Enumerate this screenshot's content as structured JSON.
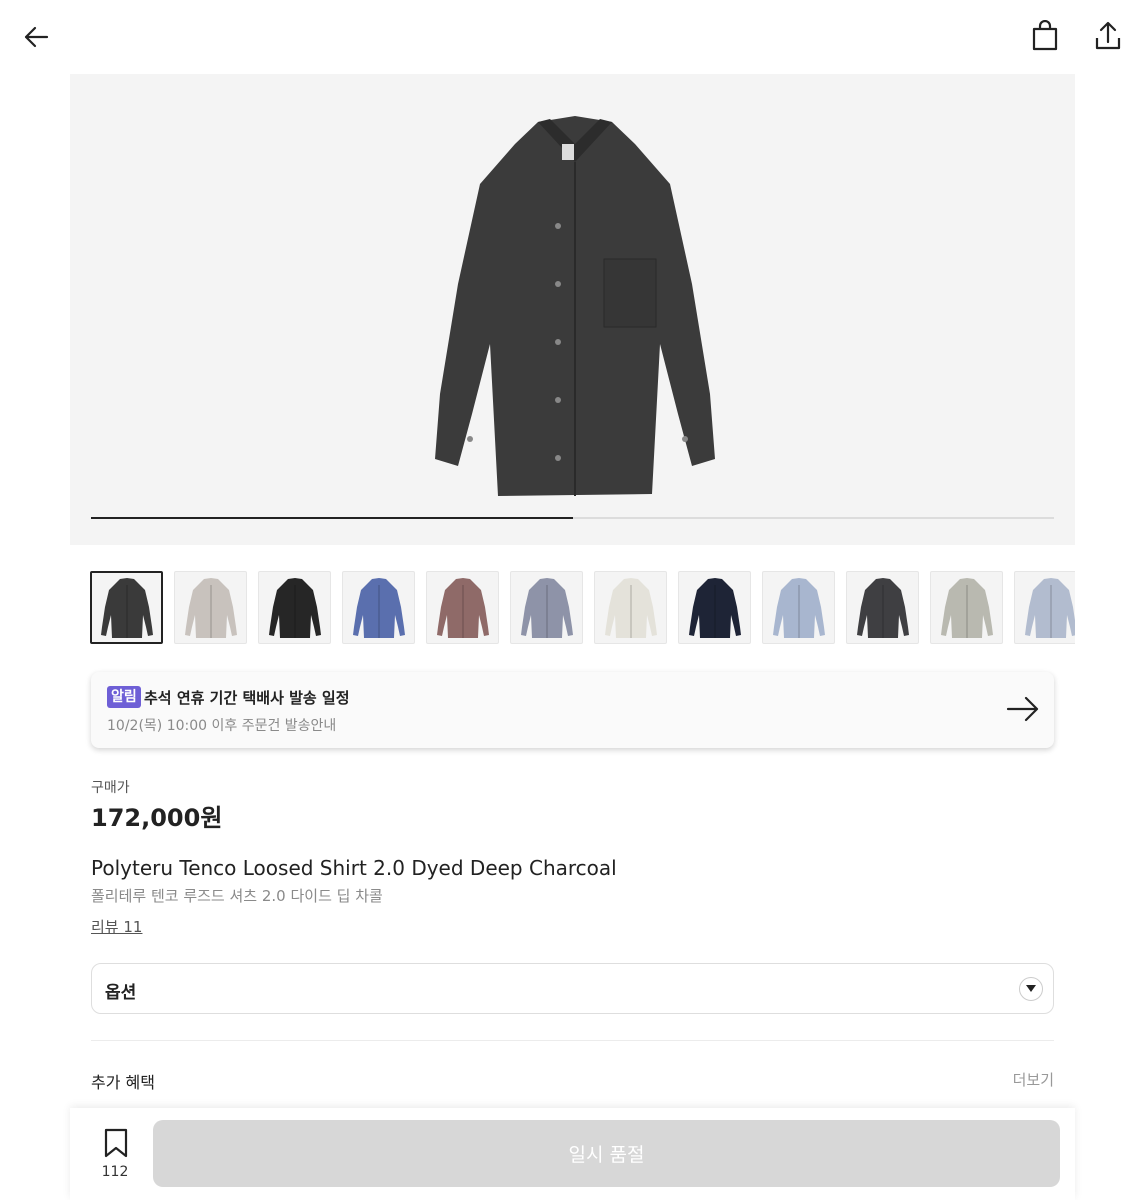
{
  "header": {
    "back_icon": "arrow-left-icon",
    "bag_icon": "shopping-bag-icon",
    "share_icon": "share-upload-icon"
  },
  "gallery": {
    "main_image": "shirt-deep-charcoal",
    "progress": 0.5,
    "thumbnails": [
      {
        "name": "deep-charcoal",
        "color": "#3a3a3a",
        "active": true
      },
      {
        "name": "light-greige",
        "color": "#c8c2bd"
      },
      {
        "name": "black",
        "color": "#262626"
      },
      {
        "name": "blue",
        "color": "#5a6fae"
      },
      {
        "name": "dusty-brown",
        "color": "#8f6a68"
      },
      {
        "name": "grey-blue-stripe",
        "color": "#8e93a8"
      },
      {
        "name": "ivory",
        "color": "#e4e2da"
      },
      {
        "name": "navy",
        "color": "#1e2436"
      },
      {
        "name": "light-blue",
        "color": "#a8b6cf"
      },
      {
        "name": "charcoal-2",
        "color": "#3f3f42"
      },
      {
        "name": "sage-grey",
        "color": "#b9b9b0"
      },
      {
        "name": "pale-blue",
        "color": "#b2bccf"
      }
    ]
  },
  "notice": {
    "badge": "알림",
    "title": "추석 연휴 기간 택배사 발송 일정",
    "subtitle": "10/2(목) 10:00 이후 주문건 발송안내",
    "arrow_icon": "arrow-right-icon",
    "badge_color": "#6e5fd6"
  },
  "product": {
    "price_label": "구매가",
    "price": "172,000원",
    "name_en": "Polyteru Tenco Loosed Shirt 2.0 Dyed Deep Charcoal",
    "name_ko": "폴리테루 텐코 루즈드 셔츠 2.0 다이드 딥 차콜",
    "review_link": "리뷰 11"
  },
  "option": {
    "label": "옵션",
    "caret_icon": "caret-down-icon"
  },
  "benefits": {
    "label": "추가 혜택",
    "more": "더보기"
  },
  "bottom_bar": {
    "bookmark_icon": "bookmark-icon",
    "bookmark_count": "112",
    "soldout_label": "일시 품절",
    "soldout_color": "#d7d7d7"
  }
}
